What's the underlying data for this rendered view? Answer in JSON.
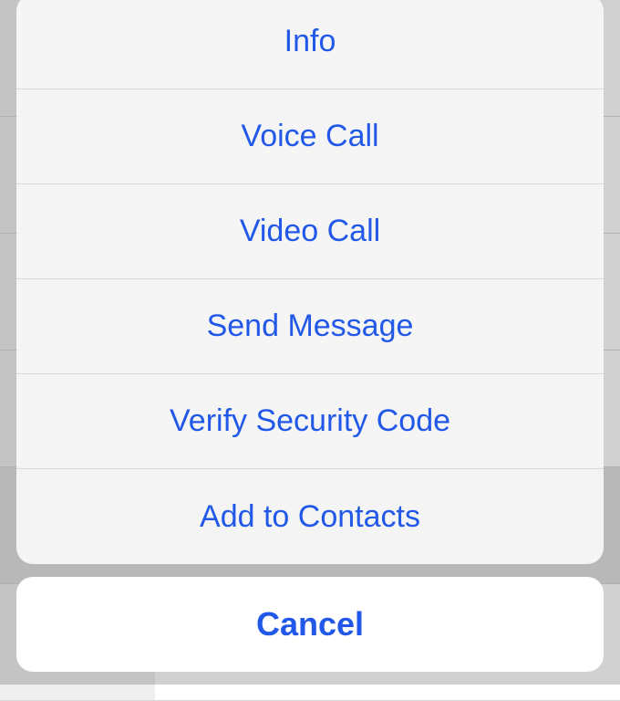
{
  "actionSheet": {
    "options": {
      "info": "Info",
      "voiceCall": "Voice Call",
      "videoCall": "Video Call",
      "sendMessage": "Send Message",
      "verifySecurityCode": "Verify Security Code",
      "addToContacts": "Add to Contacts"
    },
    "cancel": "Cancel"
  },
  "colors": {
    "actionAccent": "#2158e8",
    "sheetBackground": "#f7f7f7",
    "cancelBackground": "#ffffff"
  }
}
